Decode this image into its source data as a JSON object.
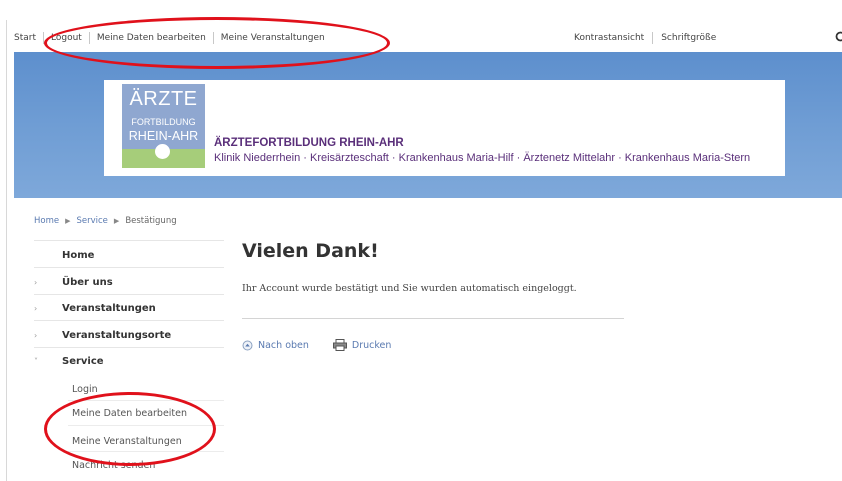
{
  "topbar": {
    "links": [
      "Start",
      "Logout",
      "Meine Daten bearbeiten",
      "Meine Veranstaltungen"
    ],
    "right_links": [
      "Kontrastansicht",
      "Schriftgröße"
    ],
    "search_value": "",
    "search_icon": "magnifier"
  },
  "banner": {
    "logo": {
      "line1": "ÄRZTE",
      "line2": "FORTBILDUNG",
      "line3": "RHEIN-AHR"
    },
    "title": "ÄRZTEFORTBILDUNG RHEIN-AHR",
    "subtitle": "Klinik Niederrhein · Kreisärzteschaft · Krankenhaus Maria-Hilf · Ärztenetz Mittelahr · Krankenhaus Maria-Stern"
  },
  "breadcrumb": {
    "home": "Home",
    "service": "Service",
    "current": "Bestätigung"
  },
  "sidebar": {
    "home": "Home",
    "items": [
      "Über uns",
      "Veranstaltungen",
      "Veranstaltungsorte",
      "Service"
    ],
    "sub_items": [
      "Login",
      "Meine Daten bearbeiten",
      "Meine Veranstaltungen",
      "Nachricht senden"
    ]
  },
  "main": {
    "title": "Vielen Dank!",
    "text": "Ihr Account wurde bestätigt und Sie wurden automatisch eingeloggt.",
    "actions": {
      "top": "Nach oben",
      "print": "Drucken"
    }
  },
  "colors": {
    "banner": "#6f9dd4",
    "org_text": "#5a2f7a",
    "link": "#5a7ab0",
    "annotation": "#e0111b"
  }
}
